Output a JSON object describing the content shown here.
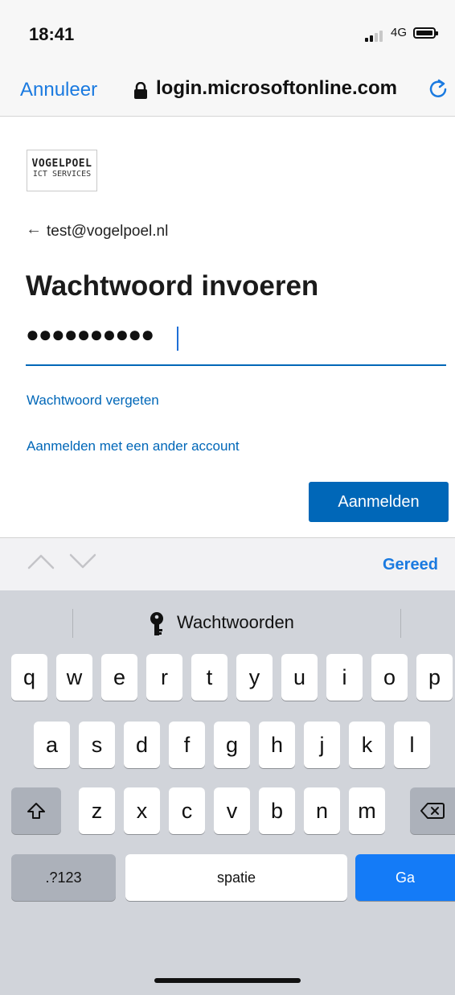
{
  "status_bar": {
    "time": "18:41",
    "network": "4G"
  },
  "browser": {
    "cancel_label": "Annuleer",
    "url": "login.microsoftonline.com"
  },
  "logo": {
    "line1": "VOGELPOEL",
    "line2": "ICT SERVICES"
  },
  "page": {
    "email": "test@vogelpoel.nl",
    "heading": "Wachtwoord invoeren",
    "password_masked": "●●●●●●●●●●",
    "forgot_link": "Wachtwoord vergeten",
    "other_account_link": "Aanmelden met een ander account",
    "signin_button": "Aanmelden"
  },
  "accessory": {
    "done_label": "Gereed"
  },
  "keyboard": {
    "suggestion": "Wachtwoorden",
    "row1": [
      "q",
      "w",
      "e",
      "r",
      "t",
      "y",
      "u",
      "i",
      "o",
      "p"
    ],
    "row2": [
      "a",
      "s",
      "d",
      "f",
      "g",
      "h",
      "j",
      "k",
      "l"
    ],
    "row3": [
      "z",
      "x",
      "c",
      "v",
      "b",
      "n",
      "m"
    ],
    "numbers_label": ".?123",
    "space_label": "spatie",
    "go_label": "Ga"
  },
  "colors": {
    "accent": "#0067b8",
    "ios_blue": "#1a7ae0",
    "go_key": "#147bf7",
    "keyboard_bg": "#d1d4da"
  }
}
